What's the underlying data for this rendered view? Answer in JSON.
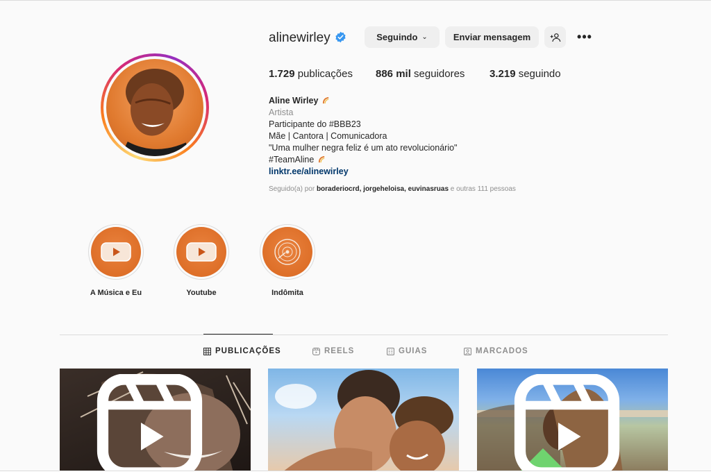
{
  "profile": {
    "username": "alinewirley",
    "buttons": {
      "following": "Seguindo",
      "message": "Enviar mensagem"
    },
    "stats": {
      "posts_count": "1.729",
      "posts_label": "publicações",
      "followers_count": "886 mil",
      "followers_label": "seguidores",
      "following_count": "3.219",
      "following_label": "seguindo"
    },
    "bio": {
      "name": "Aline Wirley",
      "category": "Artista",
      "line1": "Participante do #BBB23",
      "line2": "Mãe | Cantora | Comunicadora",
      "line3": "\"Uma mulher negra feliz é um ato revolucionário\"",
      "line4": "#TeamAline",
      "link": "linktr.ee/alinewirley"
    },
    "followed_by": {
      "prefix": "Seguido(a) por",
      "names": "boraderiocrd, jorgeheloisa, euvinasruas",
      "suffix": "e outras 111 pessoas"
    }
  },
  "highlights": [
    {
      "label": "A Música e Eu",
      "icon": "youtube-play-icon"
    },
    {
      "label": "Youtube",
      "icon": "youtube-play-icon"
    },
    {
      "label": "Indômita",
      "icon": "vinyl-record-icon"
    }
  ],
  "tabs": [
    {
      "label": "PUBLICAÇÕES",
      "icon": "grid-icon",
      "active": true
    },
    {
      "label": "REELS",
      "icon": "reels-icon",
      "active": false
    },
    {
      "label": "GUIAS",
      "icon": "guides-icon",
      "active": false
    },
    {
      "label": "MARCADOS",
      "icon": "tagged-icon",
      "active": false
    }
  ],
  "posts": [
    {
      "type": "reel"
    },
    {
      "type": "photo"
    },
    {
      "type": "reel"
    }
  ],
  "colors": {
    "background": "#fafafa",
    "verified": "#3897f0",
    "link": "#00376b",
    "highlight_fill": "#e07a2f"
  }
}
